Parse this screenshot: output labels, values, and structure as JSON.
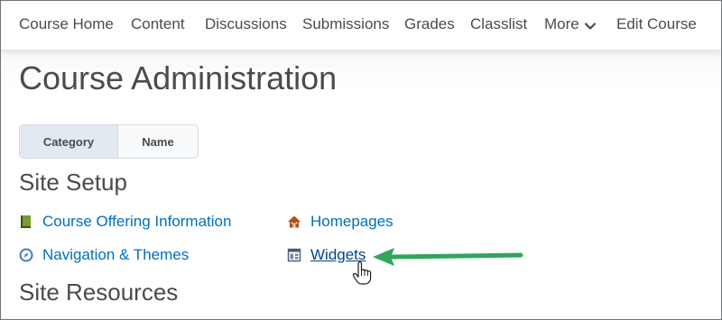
{
  "nav": {
    "items": [
      {
        "label": "Course Home"
      },
      {
        "label": "Content"
      },
      {
        "label": "Discussions"
      },
      {
        "label": "Submissions"
      },
      {
        "label": "Grades"
      },
      {
        "label": "Classlist"
      },
      {
        "label": "More"
      },
      {
        "label": "Edit Course"
      }
    ]
  },
  "page": {
    "title": "Course Administration"
  },
  "view_toggle": {
    "category_label": "Category",
    "name_label": "Name",
    "selected": "Category"
  },
  "sections": [
    {
      "title": "Site Setup",
      "links": [
        {
          "label": "Course Offering Information",
          "icon": "book-icon"
        },
        {
          "label": "Homepages",
          "icon": "home-icon"
        },
        {
          "label": "Navigation & Themes",
          "icon": "compass-icon"
        },
        {
          "label": "Widgets",
          "icon": "widgets-icon"
        }
      ]
    },
    {
      "title": "Site Resources"
    }
  ],
  "colors": {
    "link": "#006fbf",
    "text": "#494c4e",
    "arrow": "#2fa55d"
  }
}
